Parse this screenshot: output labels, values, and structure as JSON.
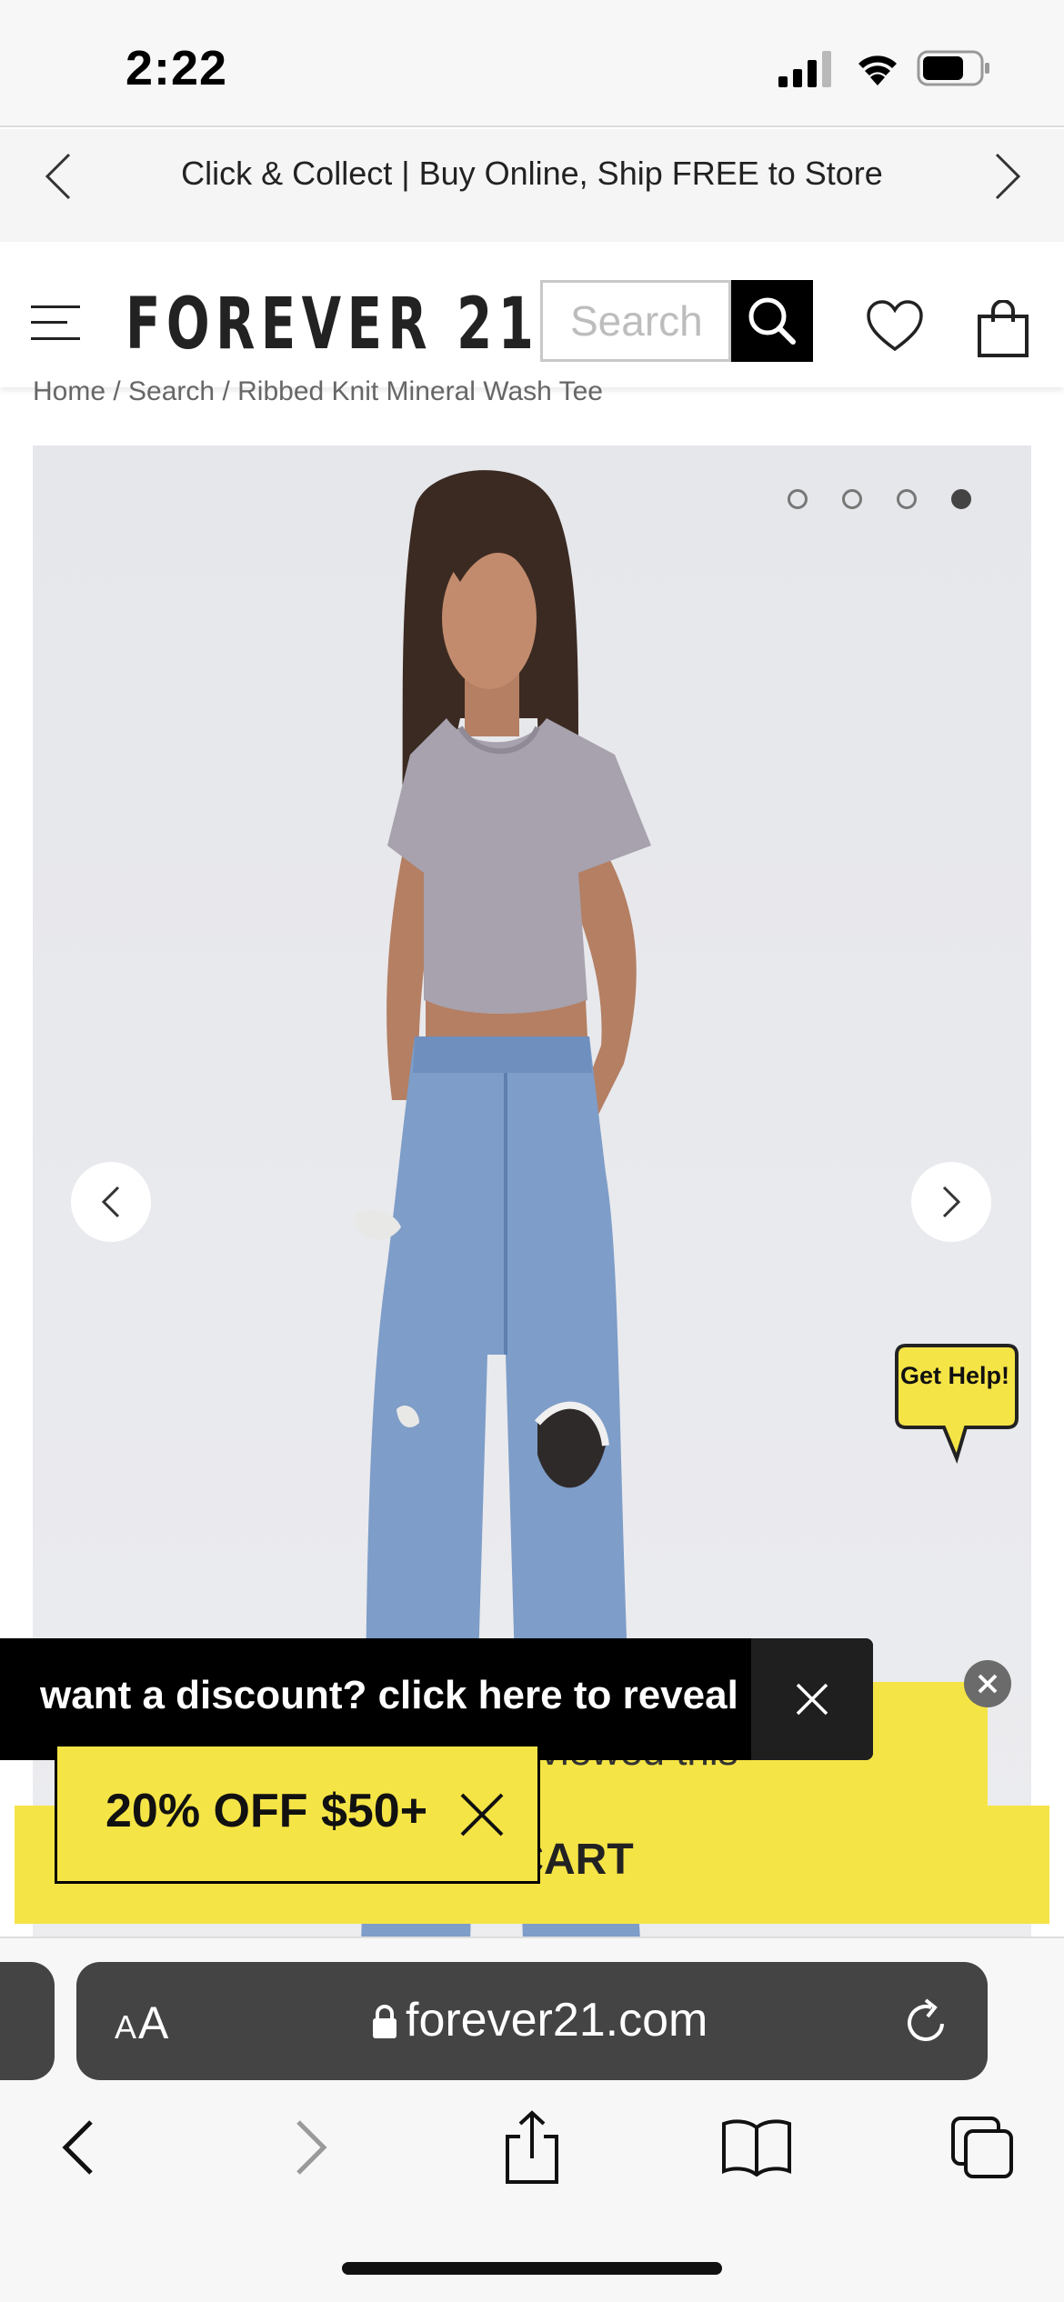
{
  "status_bar": {
    "time": "2:22"
  },
  "promo_banner": {
    "text": "Click & Collect | Buy Online, Ship FREE to Store"
  },
  "header": {
    "logo": "FOREVER 21",
    "search_placeholder": "Search"
  },
  "breadcrumb": {
    "home": "Home",
    "sep1": " / ",
    "search": "Search",
    "sep2": " / ",
    "product": "Ribbed Knit Mineral Wash Tee"
  },
  "gallery": {
    "slide_count": 4,
    "active_slide": 4
  },
  "help_bubble": {
    "label": "Get Help!"
  },
  "viewed_popup": {
    "text": "viewed this"
  },
  "cart": {
    "label": "CART"
  },
  "discount_bar": {
    "text": "want a discount? click here to reveal"
  },
  "offer_tag": {
    "text": "20% OFF $50+"
  },
  "browser": {
    "aa_small": "A",
    "aa_large": "A",
    "url": "forever21.com"
  },
  "colors": {
    "accent_yellow": "#f5e446",
    "discount_bg": "#000000",
    "url_bar_bg": "#444444"
  },
  "icons": [
    "signal-icon",
    "wifi-icon",
    "battery-icon",
    "chevron-left-icon",
    "chevron-right-icon",
    "hamburger-menu-icon",
    "search-icon",
    "heart-icon",
    "shopping-bag-icon",
    "close-icon",
    "lock-icon",
    "reload-icon",
    "share-icon",
    "book-icon",
    "tabs-icon"
  ]
}
